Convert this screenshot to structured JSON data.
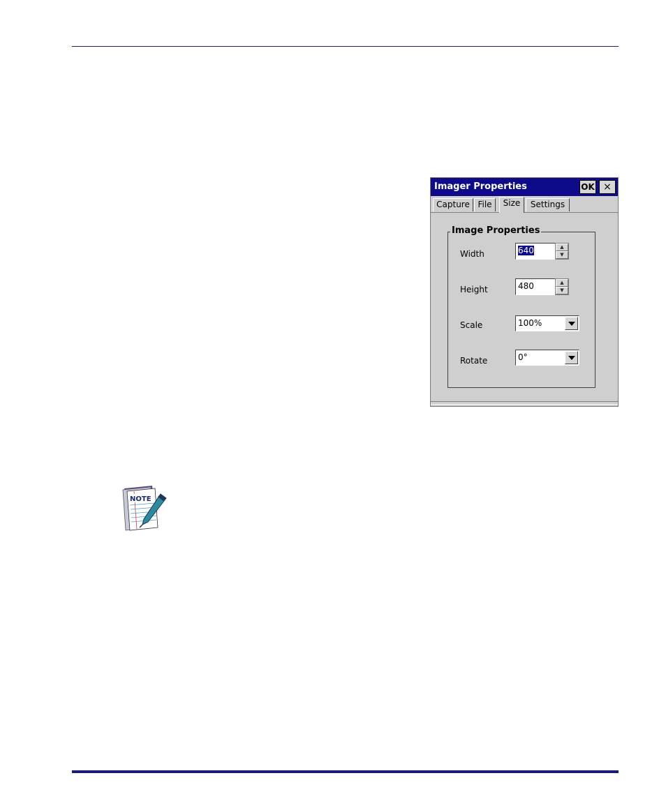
{
  "dialog": {
    "title": "Imager Properties",
    "ok_label": "OK",
    "close_label": "×",
    "tabs": [
      {
        "label": "Capture"
      },
      {
        "label": "File"
      },
      {
        "label": "Size"
      },
      {
        "label": "Settings"
      }
    ],
    "active_tab": "Size",
    "group": {
      "label": "Image Properties",
      "width_label": "Width",
      "width_value": "640",
      "height_label": "Height",
      "height_value": "480",
      "scale_label": "Scale",
      "scale_value": "100%",
      "rotate_label": "Rotate",
      "rotate_value": "0°"
    }
  },
  "note_icon": {
    "label": "NOTE"
  },
  "colors": {
    "titlebar": "#0d0b8a",
    "dialog_bg": "#cfcfcf",
    "rule": "#1c1c78"
  }
}
